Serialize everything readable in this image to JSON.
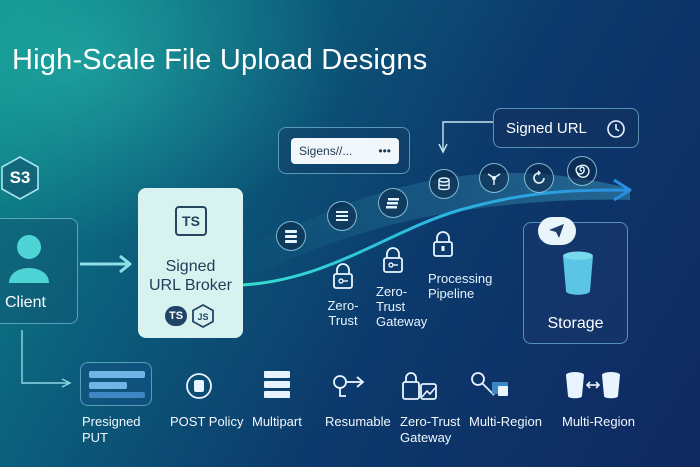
{
  "title": "High-Scale File Upload Designs",
  "s3_badge": {
    "label": "S3",
    "icon": "hexagon-icon"
  },
  "client": {
    "label": "Client",
    "icon": "user-icon"
  },
  "broker": {
    "logo": "TS",
    "line1": "Signed",
    "line2": "URL Broker",
    "badges": [
      "TS",
      "JS"
    ]
  },
  "signature_card": {
    "text": "Sigens//...",
    "dots": "•••"
  },
  "signed_url_card": {
    "label": "Signed URL",
    "icon": "clock-icon"
  },
  "storage": {
    "label": "Storage",
    "icons": [
      "cloud-send-icon",
      "bucket-icon"
    ]
  },
  "flow_nodes": [
    {
      "icon": "server-stack-icon"
    },
    {
      "icon": "list-icon"
    },
    {
      "icon": "layers-icon"
    },
    {
      "icon": "database-icon"
    },
    {
      "icon": "network-icon"
    },
    {
      "icon": "refresh-icon"
    },
    {
      "icon": "spiral-icon"
    }
  ],
  "locks": [
    {
      "label": "Zero-Trust",
      "icon": "lock-key-icon"
    },
    {
      "label": "Zero-Trust Gateway",
      "icon": "lock-key-icon"
    },
    {
      "label": "Processing Pipeline",
      "icon": "lock-icon"
    }
  ],
  "bottom_items": [
    {
      "label": "Presigned PUT",
      "icon": "form-bars-icon"
    },
    {
      "label": "POST Policy",
      "icon": "stamp-icon"
    },
    {
      "label": "Multipart",
      "icon": "stacked-blocks-icon"
    },
    {
      "label": "Resumable",
      "icon": "resume-key-icon"
    },
    {
      "label": "Zero-Trust Gateway",
      "icon": "lock-photo-icon"
    },
    {
      "label": "Multi-Region",
      "icon": "key-region-icon"
    },
    {
      "label": "Multi-Region",
      "icon": "bucket-sync-icon"
    }
  ],
  "colors": {
    "accent_teal": "#2bd2d6",
    "flow_blue": "#2f9fe0",
    "broker_bg": "#d8f2ef"
  }
}
